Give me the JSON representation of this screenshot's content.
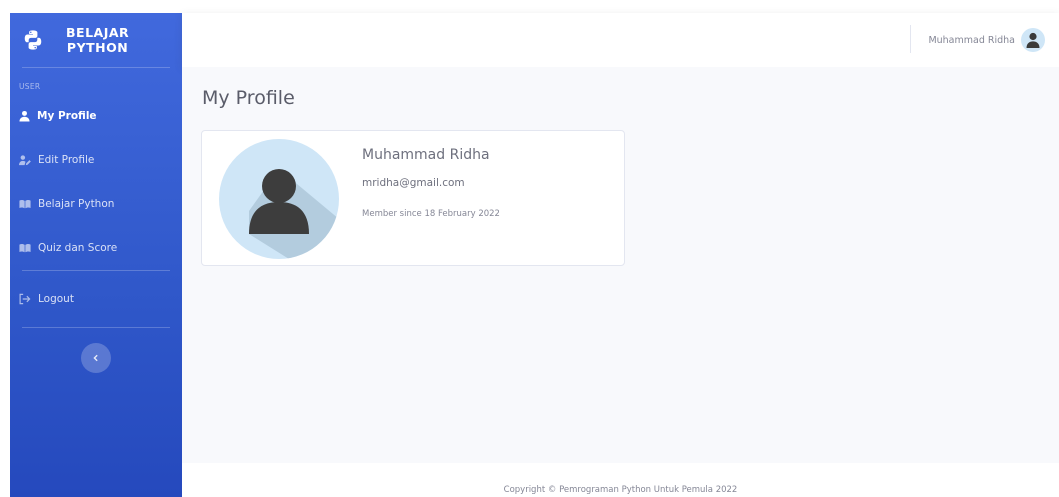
{
  "sidebar": {
    "brand_line1": "BELAJAR",
    "brand_line2": "PYTHON",
    "brand_icon": "python-logo-icon",
    "section_heading": "USER",
    "items": [
      {
        "label": "My Profile",
        "icon": "user-icon",
        "active": true
      },
      {
        "label": "Edit Profile",
        "icon": "user-edit-icon",
        "active": false
      },
      {
        "label": "Belajar Python",
        "icon": "book-open-icon",
        "active": false
      },
      {
        "label": "Quiz dan Score",
        "icon": "book-open-icon",
        "active": false
      }
    ],
    "logout_label": "Logout",
    "logout_icon": "sign-out-icon",
    "toggle_icon": "chevron-left-icon"
  },
  "topbar": {
    "user_name": "Muhammad Ridha",
    "avatar_icon": "user-avatar-icon"
  },
  "main": {
    "page_title": "My Profile",
    "profile": {
      "name": "Muhammad Ridha",
      "email": "mridha@gmail.com",
      "member_since": "Member since 18 February 2022"
    }
  },
  "footer": {
    "copyright": "Copyright © Pemrograman Python Untuk Pemula 2022"
  },
  "colors": {
    "sidebar_top": "#4169dd",
    "sidebar_bottom": "#2549bd",
    "content_bg": "#f8f9fc",
    "avatar_bg": "#cfe6f7"
  }
}
